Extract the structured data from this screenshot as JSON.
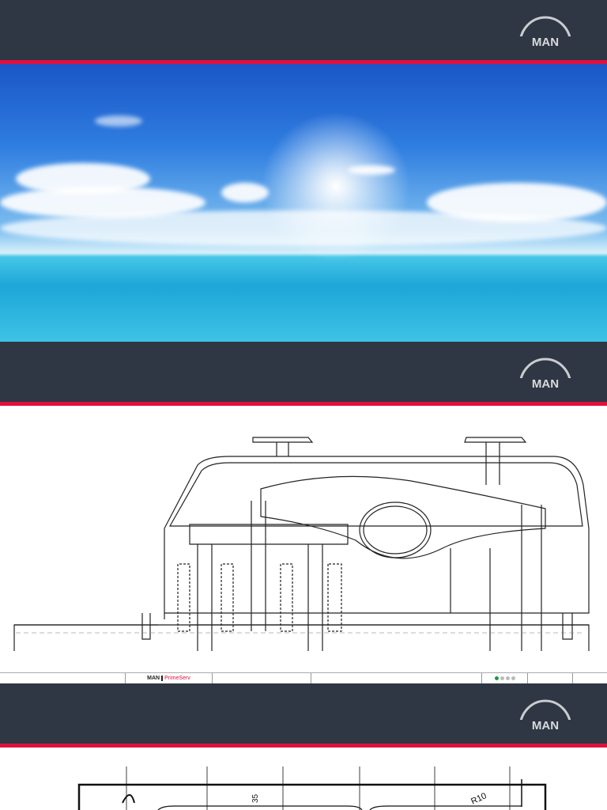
{
  "brand": {
    "logo_text": "MAN",
    "primary": "#2f3744",
    "accent": "#e0103f"
  },
  "footer": {
    "brand": "MAN",
    "product": "PrimeServ",
    "page_dots": 4,
    "active_dot": 1
  },
  "drawing2": {
    "dimension_label": "35",
    "radius_label": "R10"
  }
}
